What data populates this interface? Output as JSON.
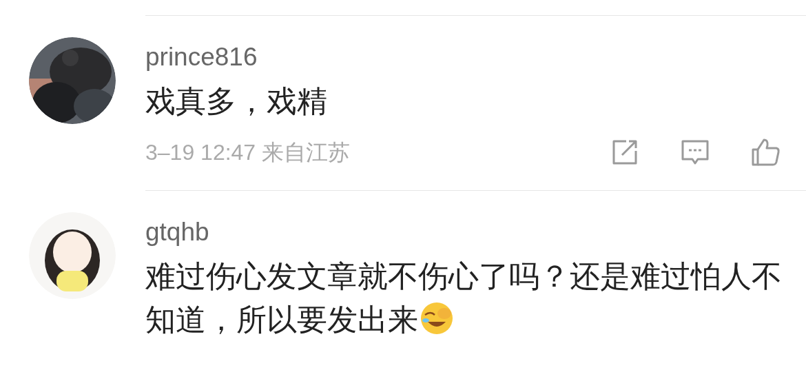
{
  "comments": [
    {
      "username": "prince816",
      "text": "戏真多，戏精",
      "trailing_emoji": false,
      "footer": {
        "time": "3–19 12:47",
        "location": "来自江苏"
      }
    },
    {
      "username": "gtqhb",
      "text": "难过伤心发文章就不伤心了吗？还是难过怕人不知道，所以要发出来",
      "trailing_emoji": true
    }
  ]
}
